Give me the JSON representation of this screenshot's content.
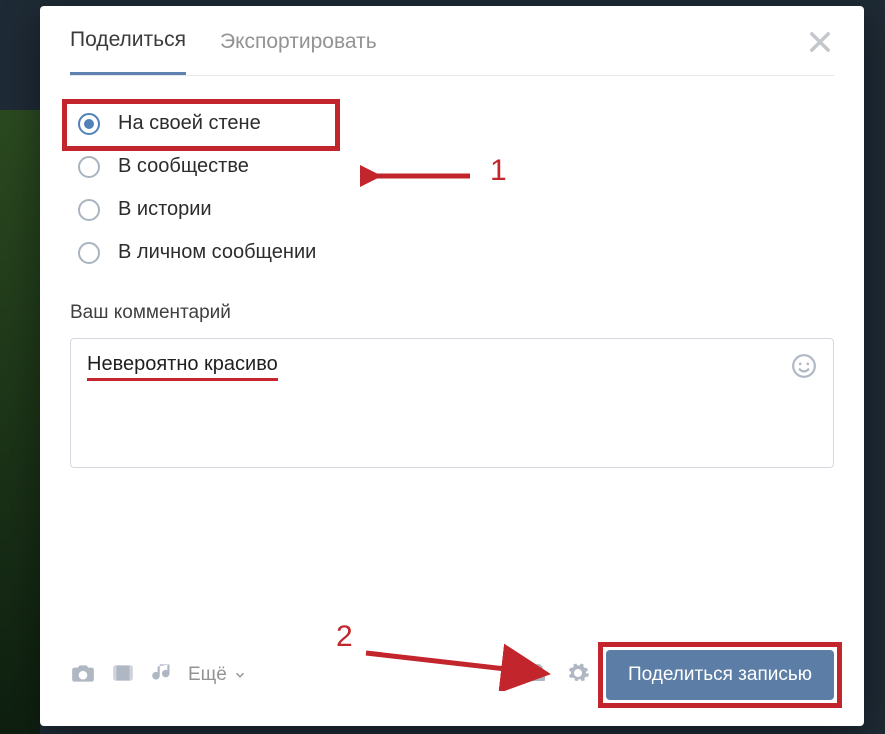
{
  "tabs": {
    "share": "Поделиться",
    "export": "Экспортировать"
  },
  "radio": {
    "wall": "На своей стене",
    "community": "В сообществе",
    "story": "В истории",
    "message": "В личном сообщении"
  },
  "comment_label": "Ваш комментарий",
  "comment_text": "Невероятно красиво",
  "more_label": "Ещё",
  "share_button": "Поделиться записью",
  "annotations": {
    "one": "1",
    "two": "2"
  }
}
